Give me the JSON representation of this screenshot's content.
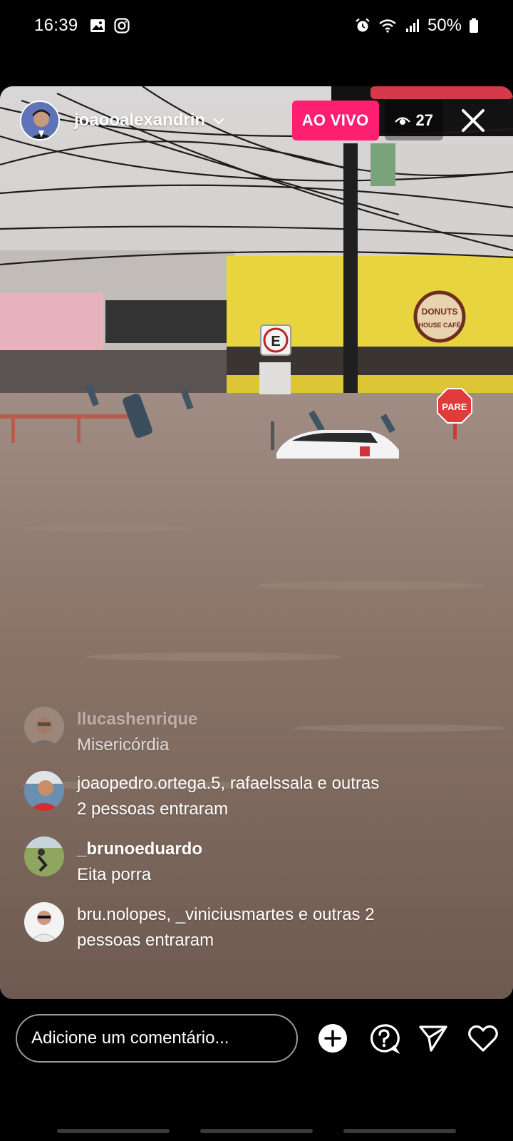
{
  "status_bar": {
    "time": "16:39",
    "battery": "50%"
  },
  "live": {
    "host_username": "joaooalexandrin",
    "live_badge": "AO VIVO",
    "viewer_count": "27"
  },
  "comments": [
    {
      "user": "llucashenrique",
      "message": "Misericórdia"
    },
    {
      "user": "",
      "message": "joaopedro.ortega.5, rafaelssala e outras",
      "message2": "2 pessoas entraram"
    },
    {
      "user": "_brunoeduardo",
      "message": "Eita porra"
    },
    {
      "user": "",
      "message": "bru.nolopes, _viniciusmartes e outras 2",
      "message2": "pessoas entraram"
    }
  ],
  "bottom_bar": {
    "comment_placeholder": "Adicione um comentário..."
  },
  "scene": {
    "sign_parking": "E",
    "sign_stop": "PARE",
    "store_sign_top": "DONUTS",
    "store_sign_bottom": "HOUSE CAFÉ"
  },
  "colors": {
    "live_pink": "#ff1f71",
    "background": "#000000"
  },
  "icons": [
    "gallery-icon",
    "instagram-icon",
    "alarm-icon",
    "wifi-icon",
    "signal-icon",
    "battery-icon",
    "chevron-down-icon",
    "eye-icon",
    "close-icon",
    "add-icon",
    "question-icon",
    "send-icon",
    "heart-icon"
  ]
}
